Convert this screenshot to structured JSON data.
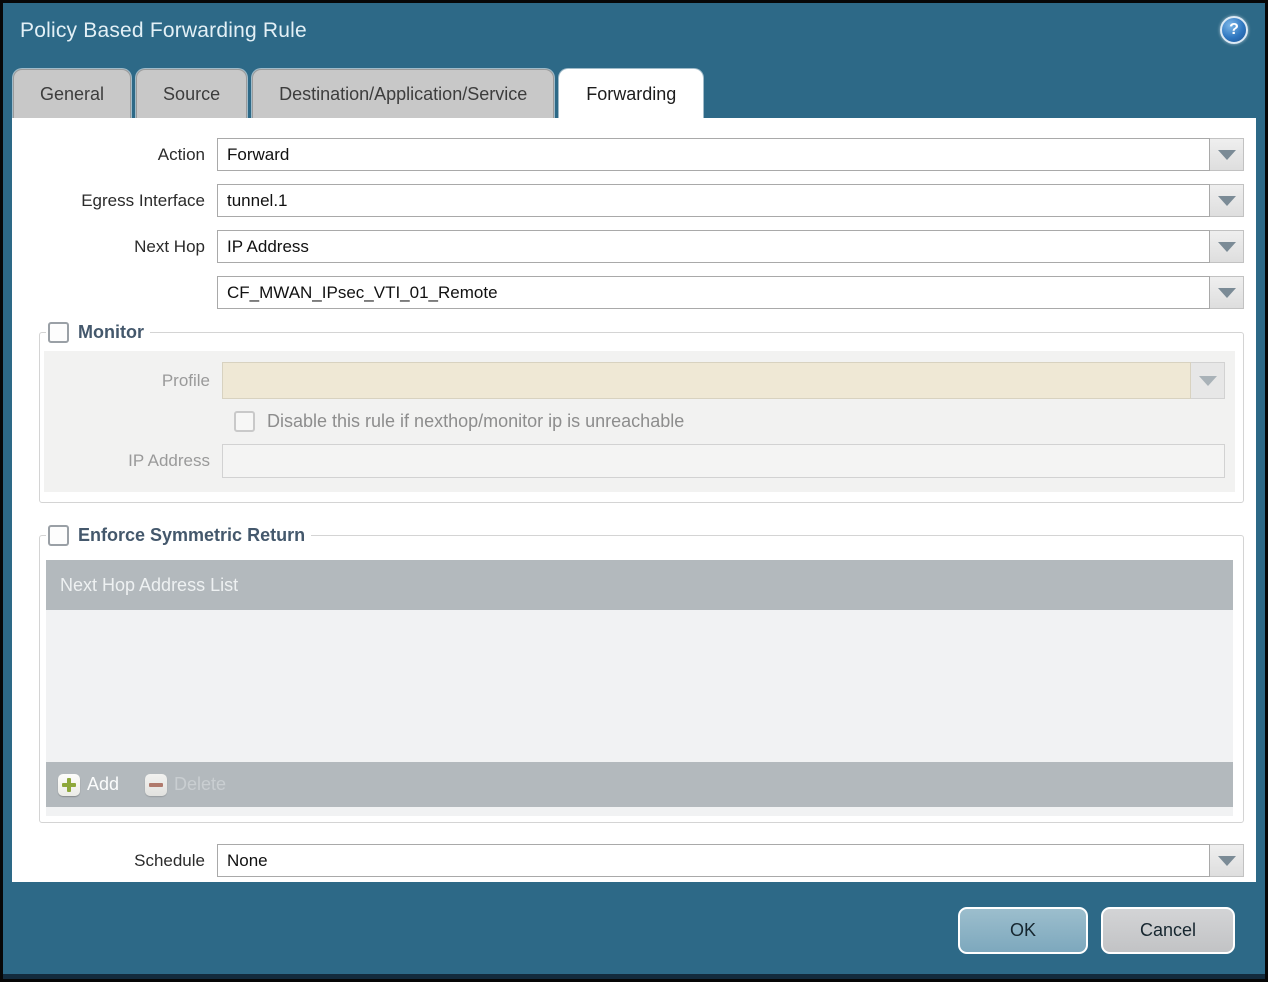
{
  "dialog": {
    "title": "Policy Based Forwarding Rule"
  },
  "icons": {
    "help_glyph": "?"
  },
  "tabs": [
    {
      "label": "General"
    },
    {
      "label": "Source"
    },
    {
      "label": "Destination/Application/Service"
    },
    {
      "label": "Forwarding"
    }
  ],
  "form": {
    "action": {
      "label": "Action",
      "value": "Forward"
    },
    "egress_interface": {
      "label": "Egress Interface",
      "value": "tunnel.1"
    },
    "next_hop": {
      "label": "Next Hop",
      "value": "IP Address"
    },
    "next_hop_address": {
      "value": "CF_MWAN_IPsec_VTI_01_Remote"
    },
    "schedule": {
      "label": "Schedule",
      "value": "None"
    }
  },
  "monitor": {
    "legend": "Monitor",
    "checked": false,
    "profile": {
      "label": "Profile",
      "value": ""
    },
    "disable_rule": {
      "label": "Disable this rule if nexthop/monitor ip is unreachable",
      "checked": false
    },
    "ip_address": {
      "label": "IP Address",
      "value": ""
    }
  },
  "symmetric_return": {
    "legend": "Enforce Symmetric Return",
    "checked": false,
    "table": {
      "header": "Next Hop Address List",
      "rows": []
    },
    "add_label": "Add",
    "delete_label": "Delete"
  },
  "footer": {
    "ok_label": "OK",
    "cancel_label": "Cancel"
  }
}
